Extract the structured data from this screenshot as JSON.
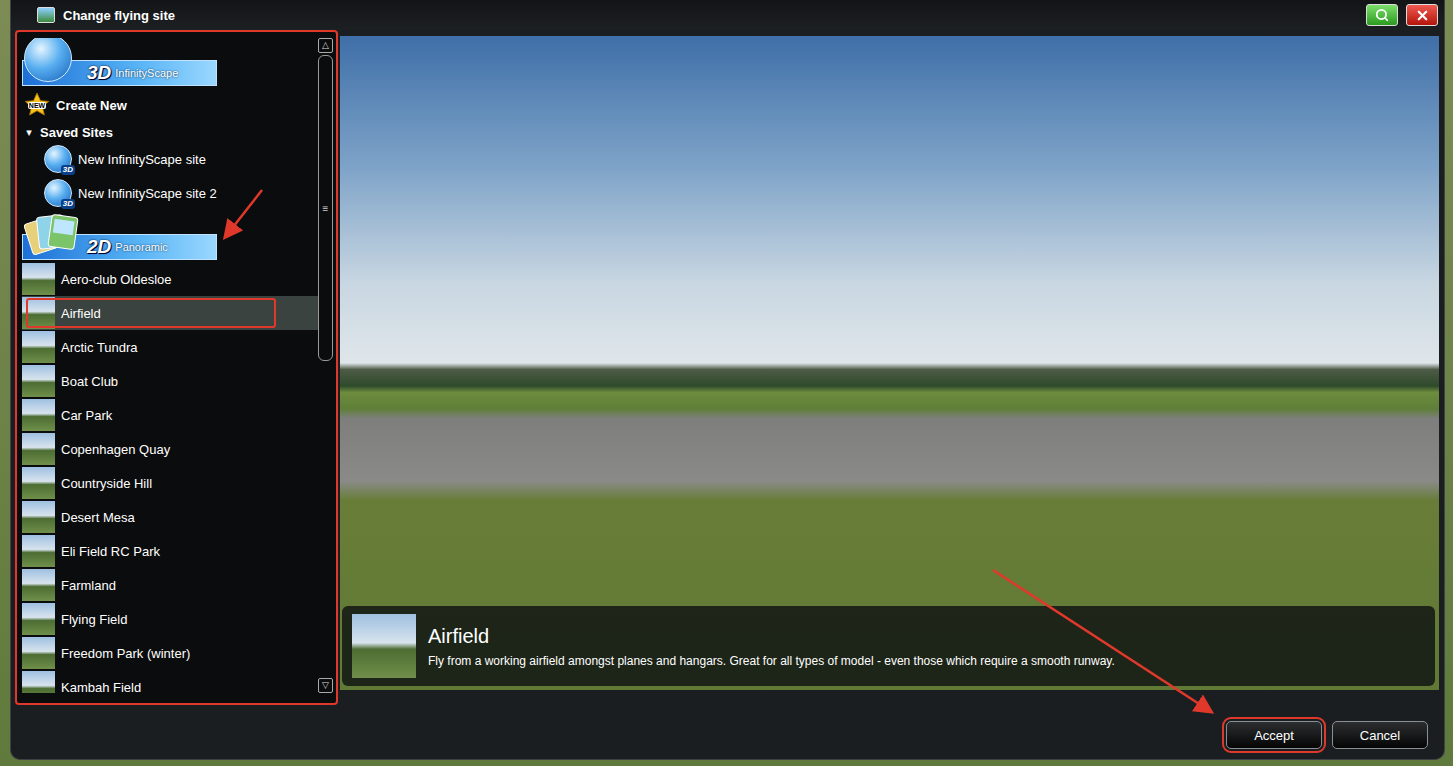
{
  "window": {
    "title": "Change flying site"
  },
  "sidebar": {
    "highlighted": true,
    "infinityscape": {
      "badge": "3D",
      "label": "InfinityScape"
    },
    "create_new": {
      "badge": "NEW",
      "label": "Create New"
    },
    "saved_sites": {
      "label": "Saved Sites",
      "toggle": "▾",
      "expanded": true,
      "items": [
        {
          "label": "New InfinityScape site",
          "badge": "3D"
        },
        {
          "label": "New InfinityScape site 2",
          "badge": "3D"
        }
      ]
    },
    "panoramic": {
      "badge": "2D",
      "label": "Panoramic",
      "highlighted": true,
      "items": [
        {
          "label": "Aero-club Oldesloe",
          "selected": false,
          "highlighted": false
        },
        {
          "label": "Airfield",
          "selected": true,
          "highlighted": true
        },
        {
          "label": "Arctic Tundra",
          "selected": false,
          "highlighted": false
        },
        {
          "label": "Boat Club",
          "selected": false,
          "highlighted": false
        },
        {
          "label": "Car Park",
          "selected": false,
          "highlighted": false
        },
        {
          "label": "Copenhagen Quay",
          "selected": false,
          "highlighted": false
        },
        {
          "label": "Countryside Hill",
          "selected": false,
          "highlighted": false
        },
        {
          "label": "Desert Mesa",
          "selected": false,
          "highlighted": false
        },
        {
          "label": "Eli Field RC Park",
          "selected": false,
          "highlighted": false
        },
        {
          "label": "Farmland",
          "selected": false,
          "highlighted": false
        },
        {
          "label": "Flying Field",
          "selected": false,
          "highlighted": false
        },
        {
          "label": "Freedom Park (winter)",
          "selected": false,
          "highlighted": false
        },
        {
          "label": "Kambah Field",
          "selected": false,
          "highlighted": false
        }
      ]
    }
  },
  "scrollbar": {
    "up": "△",
    "down": "▽",
    "grip": "≡",
    "level": 0.49
  },
  "preview": {
    "title": "Airfield",
    "description": "Fly from a working airfield amongst planes and hangars. Great for all types of model - even those which require a smooth runway."
  },
  "buttons": [
    {
      "label": "Accept",
      "highlighted": true
    },
    {
      "label": "Cancel",
      "highlighted": false
    }
  ]
}
